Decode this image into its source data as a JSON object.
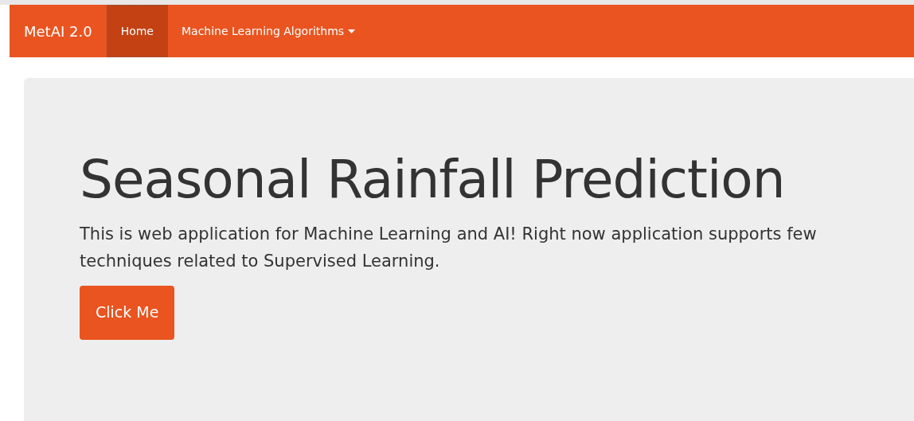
{
  "navbar": {
    "brand": "MetAI 2.0",
    "items": [
      {
        "label": "Home",
        "selected": true,
        "dropdown": false
      },
      {
        "label": "Machine Learning Algorithms",
        "selected": false,
        "dropdown": true
      }
    ]
  },
  "hero": {
    "title": "Seasonal Rainfall Prediction",
    "text": "This is web application for Machine Learning and AI! Right now application supports few techniques related to Supervised Learning.",
    "button": "Click Me"
  }
}
